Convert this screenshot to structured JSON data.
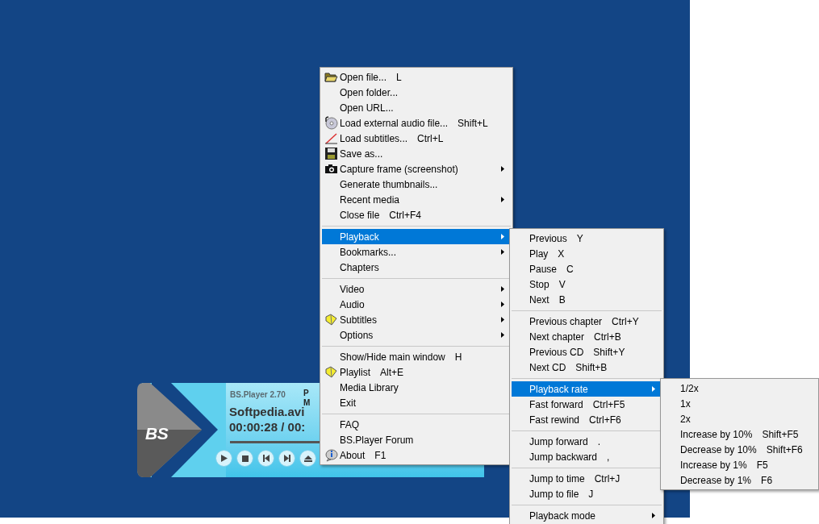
{
  "player": {
    "logo": "BS",
    "version": "BS.Player 2.70",
    "info_letters": [
      "P",
      "M"
    ],
    "file_name": "Softpedia.avi",
    "time": "00:00:28 / 00:"
  },
  "main_menu": {
    "groups": [
      [
        {
          "label": "Open file...",
          "shortcut": "L",
          "submenu": false,
          "selected": false
        },
        {
          "label": "Open folder...",
          "submenu": false,
          "selected": false
        },
        {
          "label": "Open URL...",
          "submenu": false,
          "selected": false
        },
        {
          "label": "Load external audio file...",
          "shortcut": "Shift+L",
          "submenu": false,
          "selected": false
        },
        {
          "label": "Load subtitles...",
          "shortcut": "Ctrl+L",
          "submenu": false,
          "selected": false
        },
        {
          "label": "Save as...",
          "submenu": false,
          "selected": false
        },
        {
          "label": "Capture frame (screenshot)",
          "submenu": true,
          "selected": false
        },
        {
          "label": "Generate thumbnails...",
          "submenu": false,
          "selected": false
        },
        {
          "label": "Recent media",
          "submenu": true,
          "selected": false
        },
        {
          "label": "Close file",
          "shortcut": "Ctrl+F4",
          "submenu": false,
          "selected": false
        }
      ],
      [
        {
          "label": "Playback",
          "submenu": true,
          "selected": true
        },
        {
          "label": "Bookmarks...",
          "submenu": true,
          "selected": false
        },
        {
          "label": "Chapters",
          "submenu": false,
          "selected": false
        }
      ],
      [
        {
          "label": "Video",
          "submenu": true,
          "selected": false
        },
        {
          "label": "Audio",
          "submenu": true,
          "selected": false
        },
        {
          "label": "Subtitles",
          "submenu": true,
          "selected": false
        },
        {
          "label": "Options",
          "submenu": true,
          "selected": false
        }
      ],
      [
        {
          "label": "Show/Hide main window",
          "shortcut": "H",
          "submenu": false,
          "selected": false
        },
        {
          "label": "Playlist",
          "shortcut": "Alt+E",
          "submenu": false,
          "selected": false
        },
        {
          "label": "Media Library",
          "submenu": false,
          "selected": false
        },
        {
          "label": "Exit",
          "submenu": false,
          "selected": false
        }
      ],
      [
        {
          "label": "FAQ",
          "submenu": false,
          "selected": false
        },
        {
          "label": "BS.Player Forum",
          "submenu": false,
          "selected": false
        },
        {
          "label": "About",
          "shortcut": "F1",
          "submenu": false,
          "selected": false
        }
      ]
    ]
  },
  "playback_menu": {
    "groups": [
      [
        {
          "label": "Previous",
          "shortcut": "Y",
          "submenu": false,
          "selected": false
        },
        {
          "label": "Play",
          "shortcut": "X",
          "submenu": false,
          "selected": false
        },
        {
          "label": "Pause",
          "shortcut": "C",
          "submenu": false,
          "selected": false
        },
        {
          "label": "Stop",
          "shortcut": "V",
          "submenu": false,
          "selected": false
        },
        {
          "label": "Next",
          "shortcut": "B",
          "submenu": false,
          "selected": false
        }
      ],
      [
        {
          "label": "Previous chapter",
          "shortcut": "Ctrl+Y",
          "submenu": false,
          "selected": false
        },
        {
          "label": "Next chapter",
          "shortcut": "Ctrl+B",
          "submenu": false,
          "selected": false
        },
        {
          "label": "Previous CD",
          "shortcut": "Shift+Y",
          "submenu": false,
          "selected": false
        },
        {
          "label": "Next CD",
          "shortcut": "Shift+B",
          "submenu": false,
          "selected": false
        }
      ],
      [
        {
          "label": "Playback rate",
          "submenu": true,
          "selected": true
        },
        {
          "label": "Fast forward",
          "shortcut": "Ctrl+F5",
          "submenu": false,
          "selected": false
        },
        {
          "label": "Fast rewind",
          "shortcut": "Ctrl+F6",
          "submenu": false,
          "selected": false
        }
      ],
      [
        {
          "label": "Jump forward",
          "shortcut": ".",
          "submenu": false,
          "selected": false
        },
        {
          "label": "Jump backward",
          "shortcut": ",",
          "submenu": false,
          "selected": false
        }
      ],
      [
        {
          "label": "Jump to time",
          "shortcut": "Ctrl+J",
          "submenu": false,
          "selected": false
        },
        {
          "label": "Jump to file",
          "shortcut": "J",
          "submenu": false,
          "selected": false
        }
      ],
      [
        {
          "label": "Playback mode",
          "submenu": true,
          "selected": false
        }
      ]
    ]
  },
  "rate_menu": {
    "groups": [
      [
        {
          "label": "1/2x",
          "submenu": false,
          "selected": false
        },
        {
          "label": "1x",
          "submenu": false,
          "selected": false
        },
        {
          "label": "2x",
          "submenu": false,
          "selected": false
        },
        {
          "label": "Increase by 10%",
          "shortcut": "Shift+F5",
          "submenu": false,
          "selected": false
        },
        {
          "label": "Decrease by 10%",
          "shortcut": "Shift+F6",
          "submenu": false,
          "selected": false
        },
        {
          "label": "Increase by 1%",
          "shortcut": "F5",
          "submenu": false,
          "selected": false
        },
        {
          "label": "Decrease by 1%",
          "shortcut": "F6",
          "submenu": false,
          "selected": false
        }
      ]
    ]
  }
}
